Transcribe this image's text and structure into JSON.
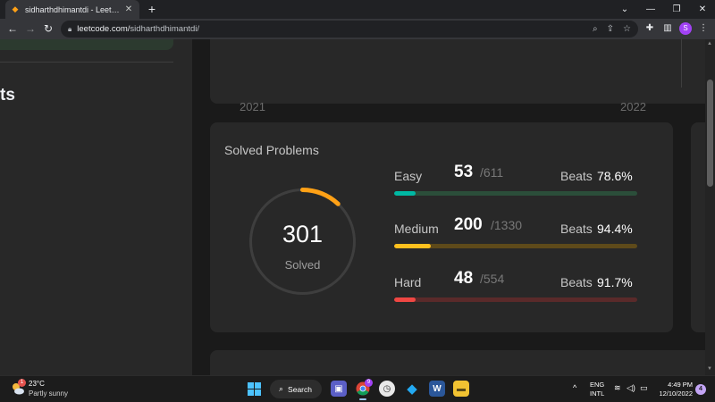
{
  "browser": {
    "tab_title": "sidharthdhimantdi - LeetCode Pr",
    "tab_close": "✕",
    "new_tab": "+",
    "url_prefix": "leetcode.com/",
    "url_path": "sidharthdhimantdi/",
    "profile_initial": "S",
    "icons": [
      "back-icon",
      "forward-icon",
      "reload-icon",
      "lock-icon",
      "search-icon",
      "share-icon",
      "star-icon",
      "extensions-icon",
      "sidebar-icon",
      "menu-icon"
    ]
  },
  "page": {
    "left_heading": "ts",
    "calendar_years": [
      "2021",
      "2022"
    ],
    "solved": {
      "title": "Solved Problems",
      "total": "301",
      "label": "Solved",
      "rows": [
        {
          "name": "Easy",
          "count": "53",
          "total": "/611",
          "beats_label": "Beats",
          "beats": "78.6%",
          "progress": 0.087
        },
        {
          "name": "Medium",
          "count": "200",
          "total": "/1330",
          "beats_label": "Beats",
          "beats": "94.4%",
          "progress": 0.15
        },
        {
          "name": "Hard",
          "count": "48",
          "total": "/554",
          "beats_label": "Beats",
          "beats": "91.7%",
          "progress": 0.087
        }
      ],
      "ring_progress": 0.12,
      "colors": {
        "easy": "#00b8a3",
        "medium": "#ffc01e",
        "hard": "#ef4743",
        "ring": "#ffa116"
      }
    }
  },
  "taskbar": {
    "weather_temp": "23°C",
    "weather_desc": "Partly sunny",
    "weather_badge": "1",
    "search_label": "Search",
    "chrome_badge": "9",
    "lang_line1": "ENG",
    "lang_line2": "INTL",
    "time": "4:49 PM",
    "date": "12/10/2022",
    "notifications": "4"
  }
}
